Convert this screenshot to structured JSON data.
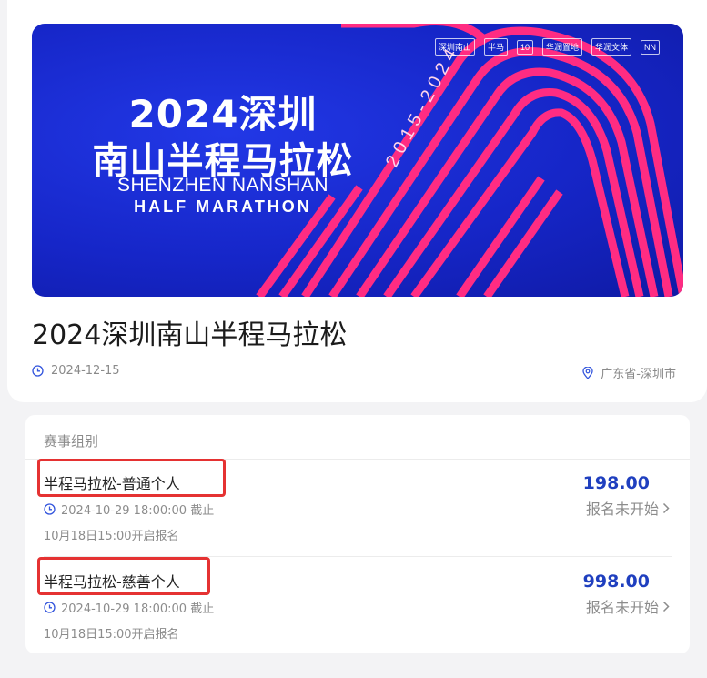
{
  "event": {
    "banner": {
      "title_line1": "2024深圳",
      "title_line2": "南山半程马拉松",
      "subtitle_line1": "SHENZHEN NANSHAN",
      "subtitle_line2": "HALF MARATHON",
      "years": "2015-2024",
      "logos": [
        "深圳南山",
        "半马",
        "10",
        "华润置地",
        "华润文体",
        "NN"
      ]
    },
    "title": "2024深圳南山半程马拉松",
    "date": "2024-12-15",
    "location": "广东省-深圳市"
  },
  "groups": {
    "header": "赛事组别",
    "items": [
      {
        "name": "半程马拉松-普通个人",
        "deadline": "2024-10-29 18:00:00 截止",
        "open_time": "10月18日15:00开启报名",
        "price": "198.00",
        "status": "报名未开始"
      },
      {
        "name": "半程马拉松-慈善个人",
        "deadline": "2024-10-29 18:00:00 截止",
        "open_time": "10月18日15:00开启报名",
        "price": "998.00",
        "status": "报名未开始"
      }
    ]
  },
  "colors": {
    "banner_blue": "#1626c8",
    "stripe_pink": "#ff2c82",
    "price_blue": "#1f3fbf",
    "highlight_red": "#e53232"
  }
}
